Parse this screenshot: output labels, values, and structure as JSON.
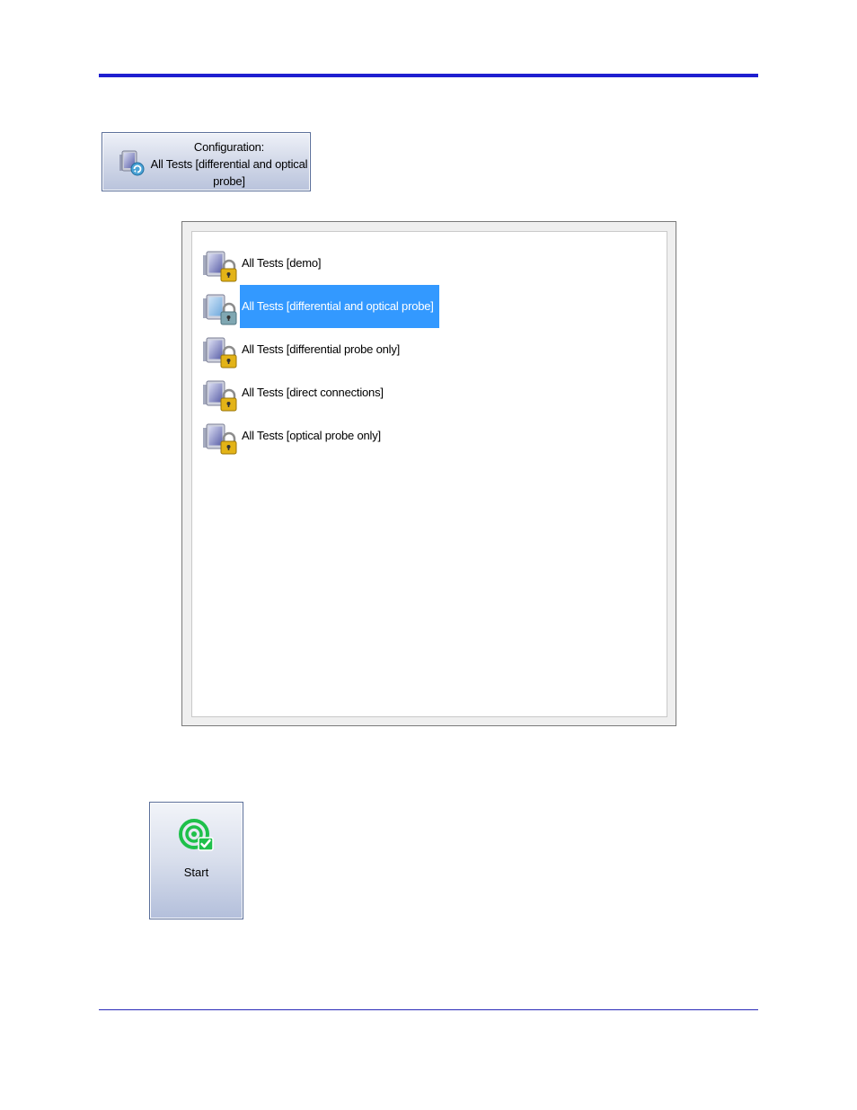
{
  "config_button": {
    "line1": "Configuration:",
    "line2": "All Tests [differential and optical",
    "line3": "probe]",
    "icon": "config-monitor-refresh-icon"
  },
  "config_list": {
    "items": [
      {
        "label": "All Tests [demo]",
        "icon": "locked-config-icon",
        "selected": false
      },
      {
        "label": "All Tests [differential and optical probe]",
        "icon": "locked-config-icon",
        "selected": true
      },
      {
        "label": "All Tests [differential probe only]",
        "icon": "locked-config-icon",
        "selected": false
      },
      {
        "label": "All Tests [direct connections]",
        "icon": "locked-config-icon",
        "selected": false
      },
      {
        "label": "All Tests [optical probe only]",
        "icon": "locked-config-icon",
        "selected": false
      }
    ],
    "selection_color": "#3399ff"
  },
  "start_button": {
    "label": "Start",
    "icon": "start-target-check-icon",
    "icon_color": "#1ec04a"
  },
  "colors": {
    "header_rule": "#1f1fd0",
    "footer_rule": "#2a2ab8"
  }
}
